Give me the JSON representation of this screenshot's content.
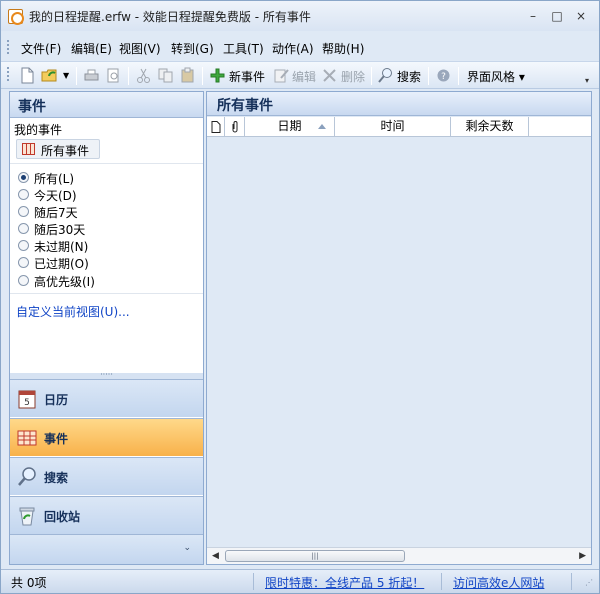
{
  "window": {
    "title": "我的日程提醒.erfw - 效能日程提醒免费版 - 所有事件",
    "minimize": "–",
    "maximize": "□",
    "close": "×"
  },
  "menu": [
    "文件(F)",
    "编辑(E)",
    "视图(V)",
    "转到(G)",
    "工具(T)",
    "动作(A)",
    "帮助(H)"
  ],
  "toolbar": {
    "new_event": "新事件",
    "edit": "编辑",
    "delete": "删除",
    "search": "搜索",
    "skin": "界面风格 ▾",
    "icons": [
      "new-document-icon",
      "open-folder-icon",
      "print-icon",
      "print-preview-icon",
      "cut-icon",
      "copy-icon",
      "paste-icon",
      "add-icon",
      "edit-icon",
      "delete-icon",
      "search-icon",
      "help-icon"
    ]
  },
  "left_panel": {
    "header": "事件",
    "my_events": "我的事件",
    "all_events_button": "所有事件",
    "filters": [
      {
        "label": "所有(L)",
        "checked": true
      },
      {
        "label": "今天(D)",
        "checked": false
      },
      {
        "label": "随后7天",
        "checked": false
      },
      {
        "label": "随后30天",
        "checked": false
      },
      {
        "label": "未过期(N)",
        "checked": false
      },
      {
        "label": "已过期(O)",
        "checked": false
      },
      {
        "label": "高优先级(I)",
        "checked": false
      }
    ],
    "customize_link": "自定义当前视图(U)...",
    "splitter": "·····",
    "nav": [
      {
        "label": "日历",
        "icon": "calendar-icon",
        "active": false
      },
      {
        "label": "事件",
        "icon": "events-grid-icon",
        "active": true
      },
      {
        "label": "搜索",
        "icon": "search-icon",
        "active": false
      },
      {
        "label": "回收站",
        "icon": "recycle-bin-icon",
        "active": false
      }
    ],
    "nav_chevron": "⌄"
  },
  "right_panel": {
    "header": "所有事件",
    "columns": [
      "日期",
      "时间",
      "剩余天数"
    ],
    "col_icons": [
      "document-icon",
      "attachment-icon"
    ],
    "rows": []
  },
  "status": {
    "count": "共 0项",
    "promo": "限时特惠：全线产品 5 折起！",
    "site": "访问高效e人网站"
  },
  "colors": {
    "accent_active": "#f8b14a",
    "header_text": "#15305a",
    "link": "#1044c6"
  }
}
